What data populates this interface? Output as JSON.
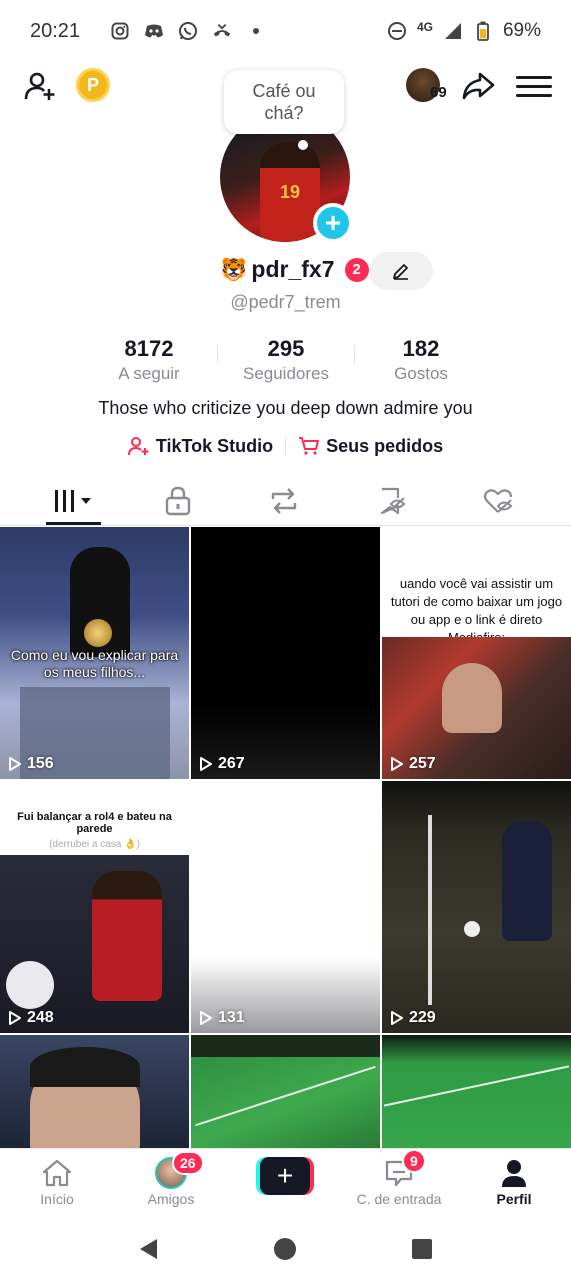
{
  "status_bar": {
    "time": "20:21",
    "network": "4G",
    "battery": "69%"
  },
  "top_bar": {
    "coin_label": "P",
    "visitors_count": "69"
  },
  "note": {
    "text": "Café ou\nchá?"
  },
  "profile": {
    "emoji": "🐯",
    "username": "pdr_fx7",
    "badge_count": "2",
    "handle": "@pedr7_trem",
    "avatar_number": "19",
    "bio": "Those who criticize you deep down admire you"
  },
  "stats": [
    {
      "value": "8172",
      "label": "A seguir"
    },
    {
      "value": "295",
      "label": "Seguidores"
    },
    {
      "value": "182",
      "label": "Gostos"
    }
  ],
  "links": {
    "studio": "TikTok Studio",
    "orders": "Seus pedidos"
  },
  "videos": [
    {
      "views": "156",
      "caption": "Como eu vou explicar para os meus filhos...",
      "top_caption": "",
      "top_sub": ""
    },
    {
      "views": "267",
      "caption": "",
      "top_caption": "",
      "top_sub": ""
    },
    {
      "views": "257",
      "caption": "",
      "top_caption": "uando você vai assistir um tutori de como baixar um jogo ou app e o link é direto Mediafire:",
      "top_sub": ""
    },
    {
      "views": "248",
      "caption": "",
      "top_caption": "Fui balançar a rol4 e bateu na parede",
      "top_sub": "(derrubei a casa 👌)"
    },
    {
      "views": "131",
      "caption": "",
      "top_caption": "",
      "top_sub": ""
    },
    {
      "views": "229",
      "caption": "",
      "top_caption": "",
      "top_sub": ""
    }
  ],
  "bottom_nav": {
    "home": "Início",
    "friends": "Amigos",
    "friends_badge": "26",
    "inbox": "C. de entrada",
    "inbox_badge": "9",
    "profile": "Perfil"
  },
  "colors": {
    "accent_red": "#fe2c55",
    "accent_cyan": "#25f4ee",
    "plus_blue": "#20c5e8",
    "coin_gold": "#f5b51e"
  }
}
